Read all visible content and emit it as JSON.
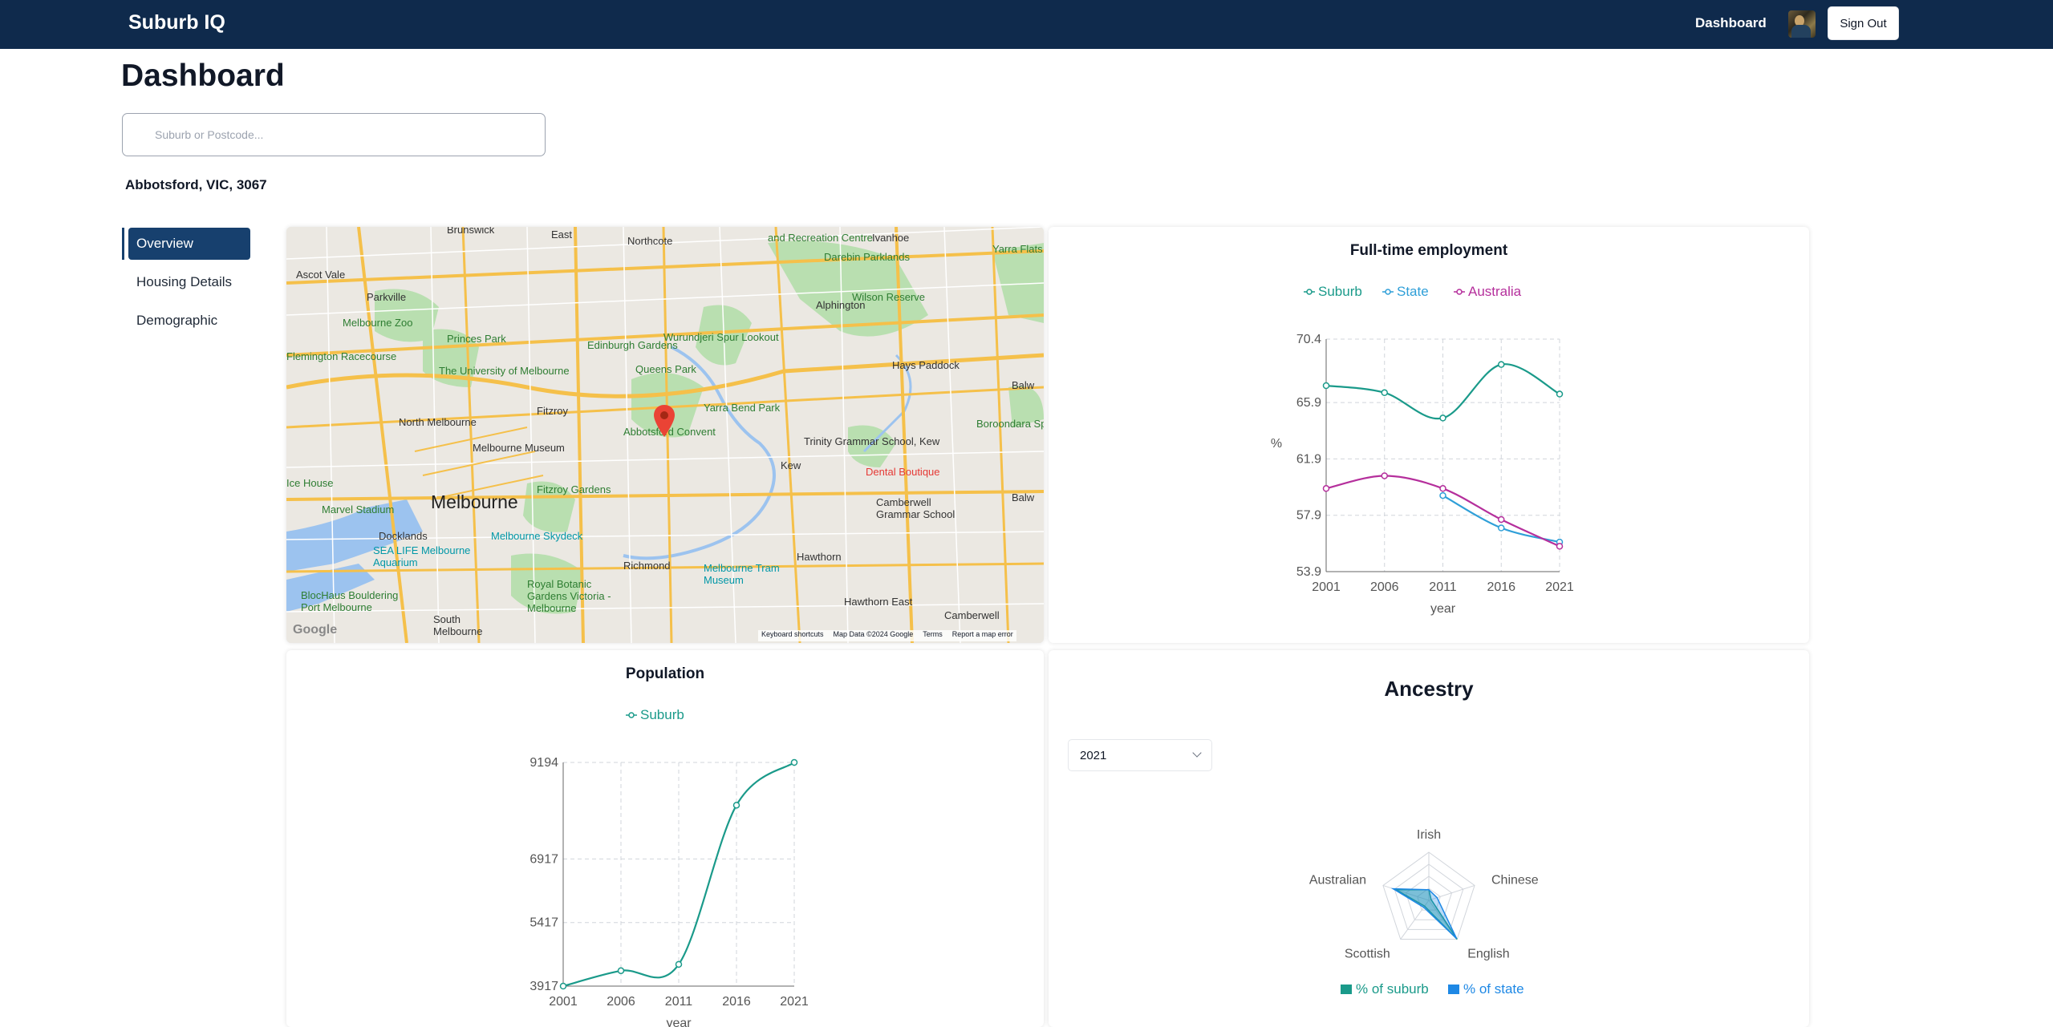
{
  "navbar": {
    "brand": "Suburb IQ",
    "dashboard_link": "Dashboard",
    "avatar": "user-avatar",
    "sign_out": "Sign Out",
    "bg_color": "#0f2a4c"
  },
  "page": {
    "title": "Dashboard",
    "search_placeholder": "Suburb or Postcode...",
    "search_value": "",
    "location": "Abbotsford, VIC, 3067"
  },
  "sidebar": {
    "items": [
      {
        "label": "Overview",
        "active": true
      },
      {
        "label": "Housing Details",
        "active": false
      },
      {
        "label": "Demographic",
        "active": false
      }
    ]
  },
  "map": {
    "labels": [
      "Brunswick",
      "East",
      "Northcote",
      "Ivanhoe",
      "Ascot Vale",
      "Parkville",
      "Alphington",
      "Darebin Parklands",
      "Yarra Flats Park",
      "Wilson Reserve",
      "Melbourne Zoo",
      "Princes Park",
      "Edinburgh Gardens",
      "Wurundjeri Spur Lookout",
      "Hays Paddock",
      "Queens Park",
      "The University of Melbourne",
      "Fitzroy",
      "Yarra Bend Park",
      "Abbotsford Convent",
      "North Melbourne",
      "Melbourne Museum",
      "Trinity Grammar School, Kew",
      "Kew",
      "Dental Boutique",
      "Melbourne",
      "Fitzroy Gardens",
      "Docklands",
      "Marvel Stadium",
      "Melbourne Skydeck",
      "SEA LIFE Melbourne Aquarium",
      "Camberwell Grammar School",
      "Richmond",
      "Hawthorn",
      "Melbourne Tram Museum",
      "Royal Botanic Gardens Victoria - Melbourne",
      "BlocHaus Bouldering Port Melbourne",
      "South Melbourne",
      "Hawthorn East",
      "Camberwell",
      "Balw",
      "Boroondara Sports Complex",
      "and Recreation Centre",
      "Flemington Racecourse",
      "Ice House"
    ],
    "footer": [
      "Keyboard shortcuts",
      "Map Data ©2024 Google",
      "Terms",
      "Report a map error"
    ],
    "logo": "Google"
  },
  "employment": {
    "title": "Full-time employment",
    "chart_data": {
      "type": "line",
      "x": [
        2001,
        2006,
        2011,
        2016,
        2021
      ],
      "xlabel": "year",
      "ylabel": "%",
      "yticks": [
        53.9,
        57.9,
        61.9,
        65.9,
        70.4
      ],
      "ylim": [
        53.9,
        70.4
      ],
      "series": [
        {
          "name": "Suburb",
          "color": "#1a9a8a",
          "values": [
            67.1,
            66.6,
            64.8,
            68.6,
            66.5
          ]
        },
        {
          "name": "State",
          "color": "#2f9fd8",
          "values": [
            null,
            null,
            59.3,
            57.0,
            56.0
          ]
        },
        {
          "name": "Australia",
          "color": "#b52f9c",
          "values": [
            59.8,
            60.7,
            59.8,
            57.6,
            55.7
          ]
        }
      ],
      "grid": true,
      "legend": "top"
    }
  },
  "population": {
    "title": "Population",
    "chart_data": {
      "type": "line",
      "x": [
        2001,
        2006,
        2011,
        2016,
        2021
      ],
      "xlabel": "year",
      "yticks": [
        3917,
        5417,
        6917,
        9194
      ],
      "ylim": [
        3917,
        9194
      ],
      "series": [
        {
          "name": "Suburb",
          "color": "#1a9a8a",
          "values": [
            3917,
            4280,
            4430,
            8185,
            9194
          ]
        }
      ],
      "grid": true,
      "legend": "top"
    }
  },
  "ancestry": {
    "title": "Ancestry",
    "year_select": "2021",
    "chart_data": {
      "type": "radar",
      "categories": [
        "Irish",
        "Chinese",
        "English",
        "Scottish",
        "Australian"
      ],
      "series": [
        {
          "name": "% of suburb",
          "color": "#1a9a8a",
          "values": [
            0.22,
            0.05,
            1.0,
            0.15,
            0.72
          ]
        },
        {
          "name": "% of state",
          "color": "#1e88e5",
          "values": [
            0.22,
            0.18,
            0.98,
            0.18,
            0.78
          ]
        }
      ],
      "legend": "bottom"
    }
  }
}
